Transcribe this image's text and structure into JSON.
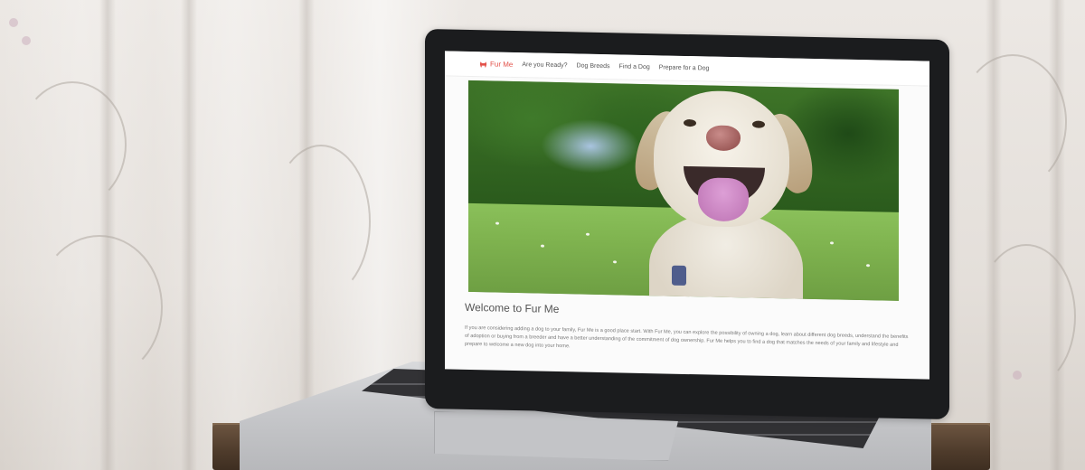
{
  "site": {
    "brand": "Fur Me",
    "nav": [
      {
        "label": "Are you Ready?"
      },
      {
        "label": "Dog Breeds"
      },
      {
        "label": "Find a Dog"
      },
      {
        "label": "Prepare for a Dog"
      }
    ],
    "welcome_title": "Welcome to Fur Me",
    "welcome_text": "If you are considering adding a dog to your family, Fur Me is a good place start. With Fur Me, you can explore the possibility of owning a dog, learn about different dog breeds, understand the benefits of adoption or buying from a breeder and have a better understanding of the commitment of dog ownership. Fur Me helps you to find a dog that matches the needs of your family and lifestyle and prepare to welcome a new dog into your home."
  },
  "colors": {
    "brand": "#e3524a",
    "nav_text": "#555555",
    "body_text": "#7a7a7a",
    "laptop_bezel": "#1b1c1e"
  },
  "icons": {
    "brand_icon": "dog-icon"
  }
}
